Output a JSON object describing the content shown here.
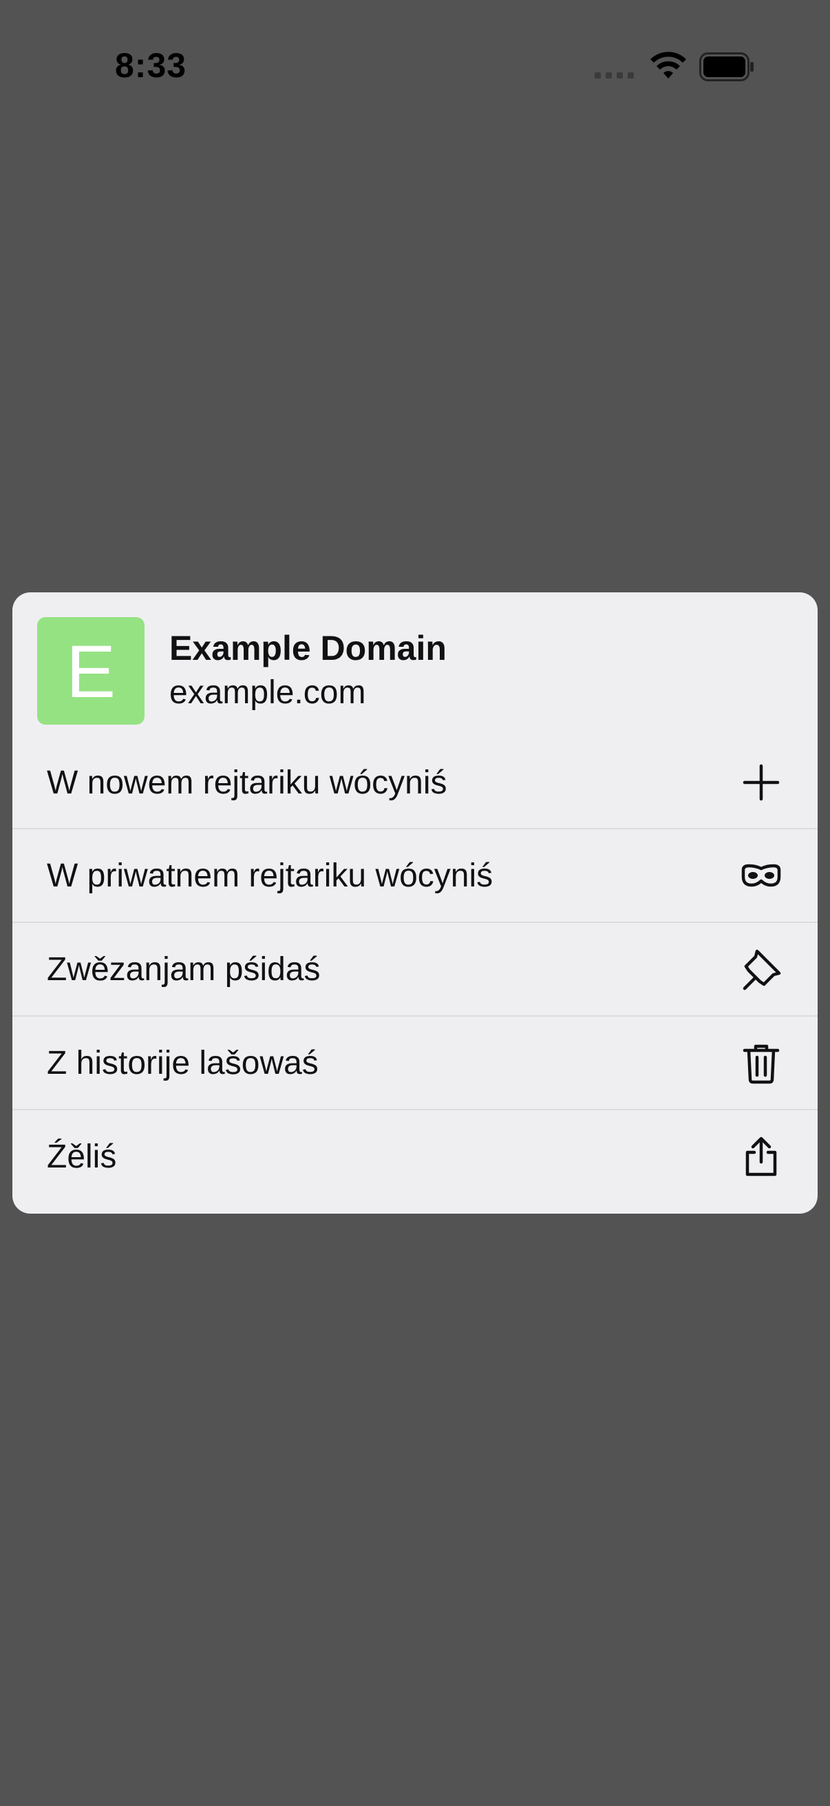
{
  "status_bar": {
    "time": "8:33"
  },
  "context_menu": {
    "favicon_letter": "E",
    "favicon_color": "#95e283",
    "title": "Example Domain",
    "domain": "example.com",
    "items": [
      {
        "label": "W nowem rejtariku wócyniś",
        "icon": "plus-icon"
      },
      {
        "label": "W priwatnem rejtariku wócyniś",
        "icon": "private-mask-icon"
      },
      {
        "label": "Zwězanjam pśidaś",
        "icon": "pin-icon"
      },
      {
        "label": "Z historije lašowaś",
        "icon": "trash-icon"
      },
      {
        "label": "Źěliś",
        "icon": "share-icon"
      }
    ]
  }
}
